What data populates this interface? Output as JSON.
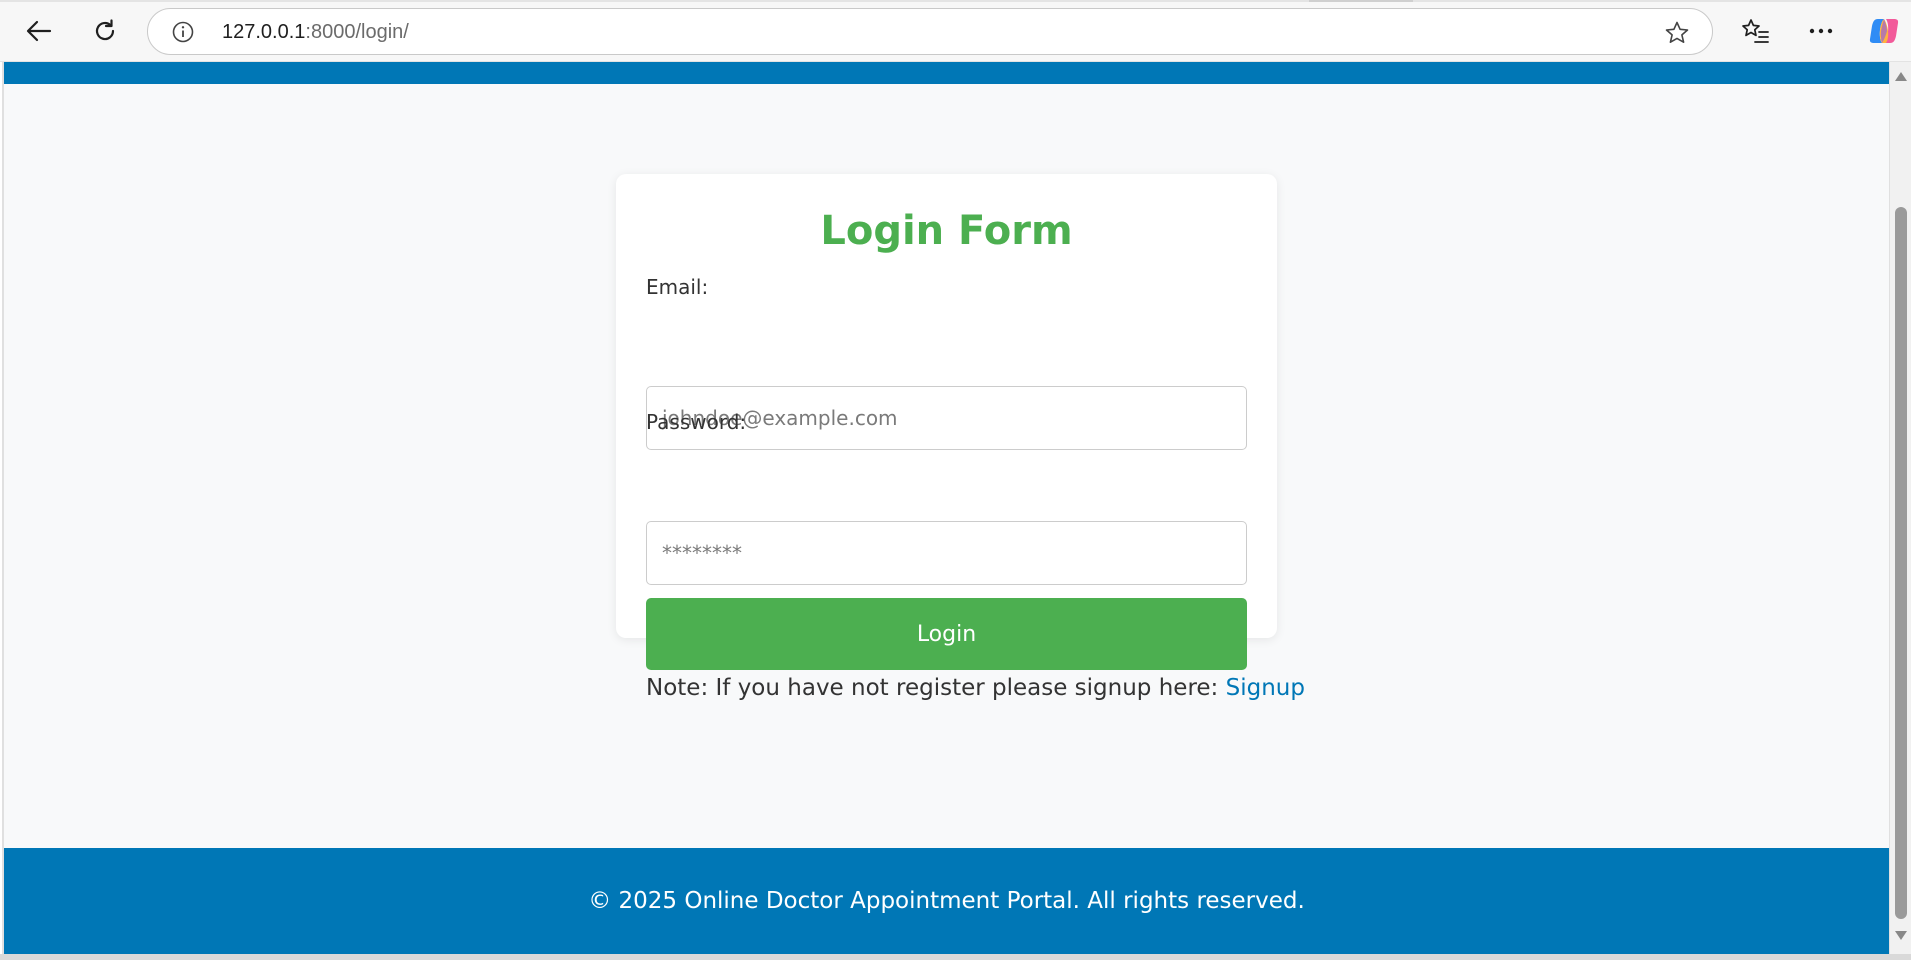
{
  "browser": {
    "url_host": "127.0.0.1",
    "url_path": ":8000/login/",
    "icons": [
      "back-icon",
      "reload-icon",
      "info-icon",
      "star-icon",
      "favorites-icon",
      "more-icon",
      "copilot-icon"
    ]
  },
  "form": {
    "title": "Login Form",
    "email_label": "Email:",
    "email_placeholder": "johndoe@example.com",
    "password_label": "Password:",
    "password_placeholder": "********",
    "submit_label": "Login"
  },
  "note": {
    "text": "Note: If you have not register please signup here: ",
    "link_label": "Signup"
  },
  "footer": {
    "text": "© 2025 Online Doctor Appointment Portal. All rights reserved."
  },
  "colors": {
    "brand_blue": "#0077b6",
    "accent_green": "#4caf50",
    "page_bg": "#f8f9fa"
  }
}
